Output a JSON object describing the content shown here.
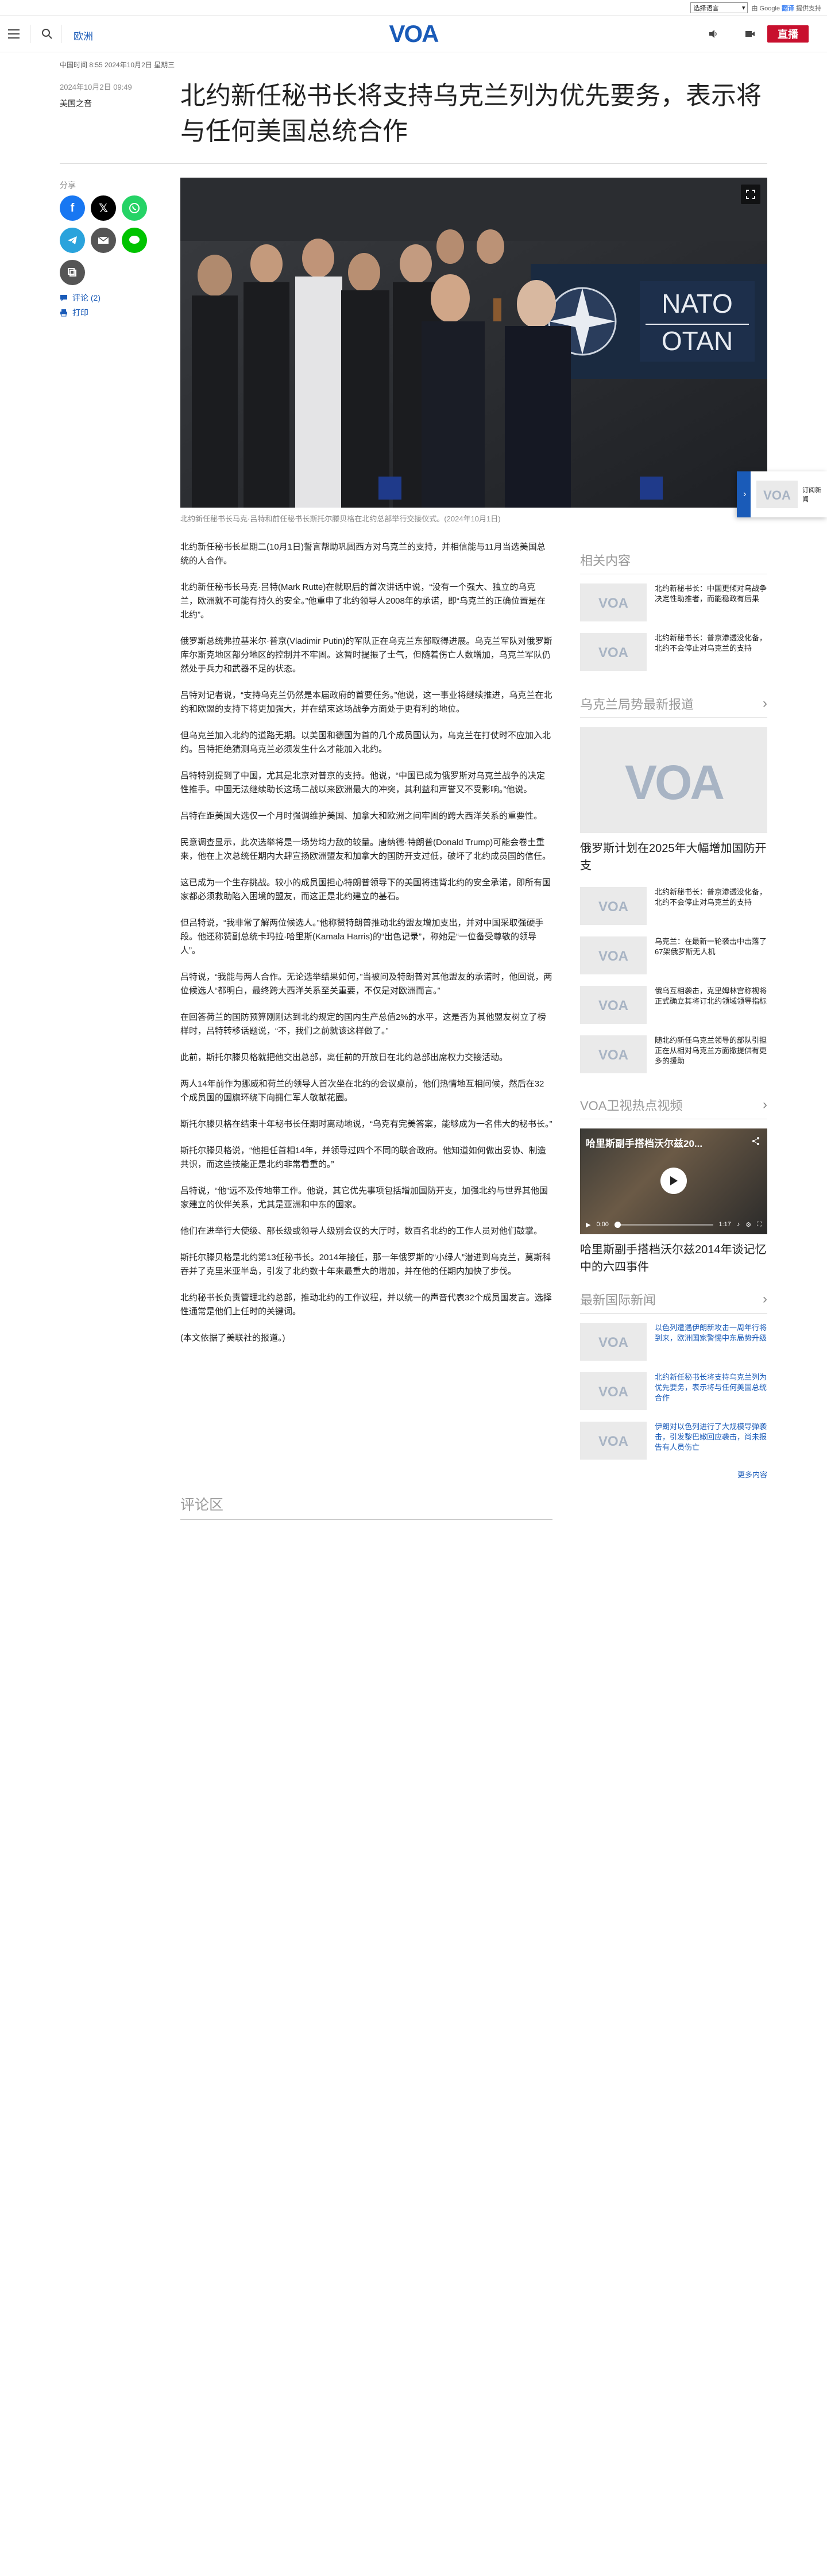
{
  "translate": {
    "select_label": "选择语言",
    "powered": "由 Google",
    "brand": "翻译",
    "powered_suffix": "提供支持"
  },
  "header": {
    "section": "欧洲",
    "live_label": "直播"
  },
  "article": {
    "timestamp_line": "中国时间 8:55 2024年10月2日 星期三",
    "date": "2024年10月2日 09:49",
    "author": "美国之音",
    "headline": "北约新任秘书长将支持乌克兰列为优先要务，表示将与任何美国总统合作",
    "share_label": "分享",
    "comments_link": "评论 (2)",
    "print_link": "打印",
    "caption": "北约新任秘书长马克·吕特和前任秘书长斯托尔滕贝格在北约总部举行交接仪式。(2024年10月1日)",
    "paragraphs": [
      "北约新任秘书长星期二(10月1日)誓言帮助巩固西方对乌克兰的支持，并相信能与11月当选美国总统的人合作。",
      "北约新任秘书长马克·吕特(Mark Rutte)在就职后的首次讲话中说，“没有一个强大、独立的乌克兰，欧洲就不可能有持久的安全。”他重申了北约领导人2008年的承诺，即“乌克兰的正确位置是在北约”。",
      "俄罗斯总统弗拉基米尔·普京(Vladimir Putin)的军队正在乌克兰东部取得进展。乌克兰军队对俄罗斯库尔斯克地区部分地区的控制并不牢固。这暂时提振了士气，但随着伤亡人数增加，乌克兰军队仍然处于兵力和武器不足的状态。",
      "吕特对记者说，“支持乌克兰仍然是本届政府的首要任务。”他说，这一事业将继续推进，乌克兰在北约和欧盟的支持下将更加强大，并在结束这场战争方面处于更有利的地位。",
      "但乌克兰加入北约的道路无期。以美国和德国为首的几个成员国认为，乌克兰在打仗时不应加入北约。吕特拒绝猜测乌克兰必须发生什么才能加入北约。",
      "吕特特别提到了中国，尤其是北京对普京的支持。他说，“中国已成为俄罗斯对乌克兰战争的决定性推手。中国无法继续助长这场二战以来欧洲最大的冲突，其利益和声誉又不受影响。”他说。",
      "吕特在距美国大选仅一个月时强调维护美国、加拿大和欧洲之间牢固的跨大西洋关系的重要性。",
      "民意调查显示，此次选举将是一场势均力敌的较量。唐纳德·特朗普(Donald Trump)可能会卷土重来，他在上次总统任期内大肆宣扬欧洲盟友和加拿大的国防开支过低，破坏了北约成员国的信任。",
      "这已成为一个生存挑战。较小的成员国担心特朗普领导下的美国将违背北约的安全承诺，即所有国家都必须救助陷入困境的盟友，而这正是北约建立的基石。",
      "但吕特说，“我非常了解两位候选人。”他称赞特朗普推动北约盟友增加支出，并对中国采取强硬手段。他还称赞副总统卡玛拉·哈里斯(Kamala Harris)的“出色记录”，称她是“一位备受尊敬的领导人”。",
      "吕特说，“我能与两人合作。无论选举结果如何，”当被问及特朗普对其他盟友的承诺时，他回说，两位候选人“都明白，最终跨大西洋关系至关重要，不仅是对欧洲而言。”",
      "在回答荷兰的国防预算刚刚达到北约规定的国内生产总值2%的水平，这是否为其他盟友树立了榜样时，吕特转移话题说，“不，我们之前就该这样做了。”",
      "此前，斯托尔滕贝格就把他交出总部，离任前的开放日在北约总部出席权力交接活动。",
      "两人14年前作为挪威和荷兰的领导人首次坐在北约的会议桌前，他们热情地互相问候，然后在32个成员国的国旗环绕下向拥仁军人敬献花圈。",
      "斯托尔滕贝格在结束十年秘书长任期时离动地说，“乌克有完美答案，能够成为一名伟大的秘书长。”",
      "斯托尔滕贝格说，“他担任首相14年，并领导过四个不同的联合政府。他知道如何做出妥协、制造共识，而这些技能正是北约非常看重的。”",
      "吕特说，“他”远不及传地带工作。他说，其它优先事项包括增加国防开支，加强北约与世界其他国家建立的伙伴关系，尤其是亚洲和中东的国家。",
      "他们在进举行大使级、部长级或领导人级别会议的大厅时，数百名北约的工作人员对他们鼓掌。",
      "斯托尔滕贝格是北约第13任秘书长。2014年接任，那一年俄罗斯的“小绿人”潜进到乌克兰，莫斯科吞并了克里米亚半岛，引发了北约数十年来最重大的增加，并在他的任期内加快了步伐。",
      "北约秘书长负责管理北约总部，推动北约的工作议程，并以统一的声音代表32个成员国发言。选择性通常是他们上任时的关键词。",
      "(本文依据了美联社的报道。)"
    ],
    "comments_title": "评论区"
  },
  "sidebar": {
    "related": {
      "title": "相关内容",
      "items": [
        "北约新秘书长：中国更倾对乌战争决定性助推者，而能稳政有后果",
        "北约新秘书长：普京渗透没化备，北约不会停止对乌克兰的支持"
      ]
    },
    "ukraine": {
      "title": "乌克兰局势最新报道",
      "lead_title": "俄罗斯计划在2025年大幅增加国防开支",
      "items": [
        "北约新秘书长：普京渗透没化备，北约不会停止对乌克兰的支持",
        "乌克兰：在最新一轮袭击中击落了67架俄罗斯无人机",
        "俄乌互相袭击，克里姆林宫称视将正式确立其将订北约领域领导指标",
        "随北约新任乌克兰领导的部队引担正在从相对乌克兰方面撤提供有更多的援助"
      ]
    },
    "video": {
      "title": "VOA卫视热点视频",
      "overlay_title": "哈里斯副手搭档沃尔兹20...",
      "time_current": "0:00",
      "time_total": "1:17",
      "caption": "哈里斯副手搭档沃尔兹2014年谈记忆中的六四事件"
    },
    "intl": {
      "title": "最新国际新闻",
      "items": [
        "以色列遭遇伊朗新攻击一周年行将到来，欧洲国家警惕中东局势升级",
        "北约新任秘书长将支持乌克兰列为优先要务，表示将与任何美国总统合作",
        "伊朗对以色列进行了大规模导弹袭击，引发黎巴嫩回应袭击，尚未报告有人员伤亡"
      ],
      "more": "更多内容"
    }
  },
  "float_tab": {
    "text": "订阅新闻"
  },
  "colors": {
    "accent": "#1a5bb8",
    "live": "#c8102e",
    "facebook": "#1877f2",
    "x": "#000000",
    "whatsapp": "#25d366",
    "telegram": "#2aa3dc",
    "email": "#555555",
    "line": "#00c300",
    "copy": "#555555"
  }
}
